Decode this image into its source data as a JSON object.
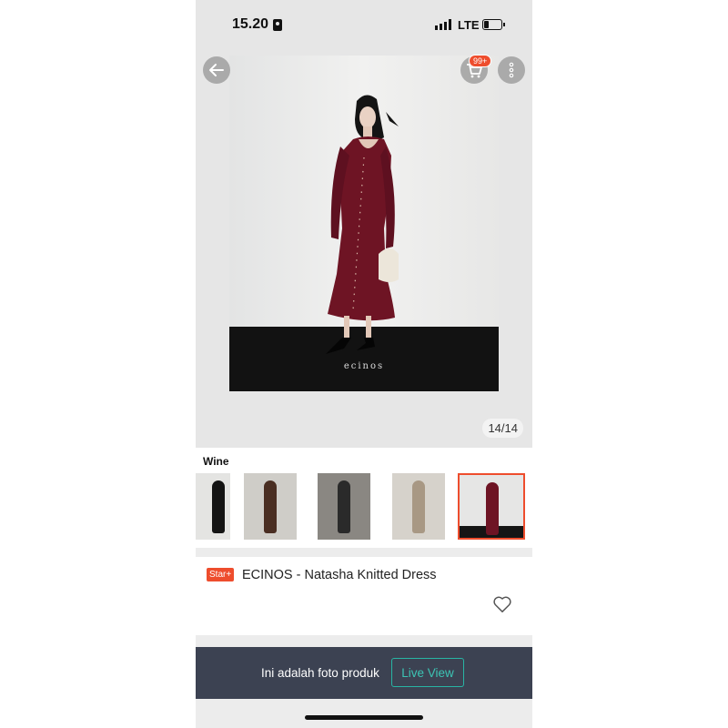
{
  "status_bar": {
    "time": "15.20",
    "network": "LTE"
  },
  "product_image": {
    "counter": "14/14",
    "brand_watermark": "ecinos"
  },
  "header": {
    "cart_badge": "99+",
    "icons": [
      "back-arrow-icon",
      "cart-icon",
      "more-vertical-icon"
    ]
  },
  "variants": {
    "label": "Wine",
    "thumbnails": [
      {
        "name": "Black"
      },
      {
        "name": "Brown"
      },
      {
        "name": "Charcoal"
      },
      {
        "name": "Beige"
      },
      {
        "name": "Wine",
        "selected": true
      }
    ]
  },
  "product": {
    "badge": "Star+",
    "title": "ECINOS - Natasha Knitted Dress"
  },
  "live_view": {
    "text": "Ini adalah foto produk",
    "button": "Live View"
  },
  "colors": {
    "accent": "#ee4d2d",
    "teal": "#28b4a4",
    "dress": "#6e1424",
    "bar": "#3c4252"
  }
}
